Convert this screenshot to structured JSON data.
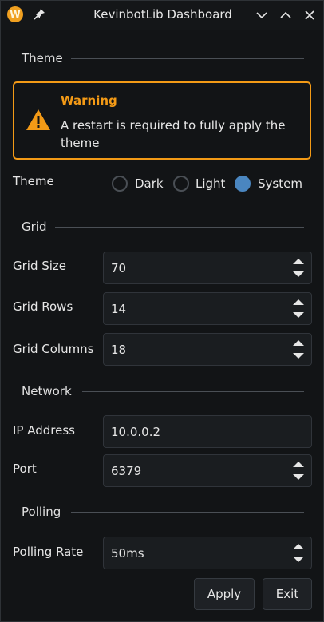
{
  "window": {
    "title": "KevinbotLib Dashboard",
    "app_icon_letter": "W"
  },
  "sections": {
    "theme": "Theme",
    "grid": "Grid",
    "network": "Network",
    "polling": "Polling"
  },
  "warning": {
    "title": "Warning",
    "text": "A restart is required to fully apply the theme"
  },
  "theme": {
    "label": "Theme",
    "options": [
      {
        "label": "Dark",
        "selected": false
      },
      {
        "label": "Light",
        "selected": false
      },
      {
        "label": "System",
        "selected": true
      }
    ]
  },
  "grid": {
    "size": {
      "label": "Grid Size",
      "value": "70"
    },
    "rows": {
      "label": "Grid Rows",
      "value": "14"
    },
    "columns": {
      "label": "Grid Columns",
      "value": "18"
    }
  },
  "network": {
    "ip": {
      "label": "IP Address",
      "value": "10.0.0.2"
    },
    "port": {
      "label": "Port",
      "value": "6379"
    }
  },
  "polling": {
    "rate": {
      "label": "Polling Rate",
      "value": "50ms"
    }
  },
  "buttons": {
    "apply": "Apply",
    "exit": "Exit"
  },
  "colors": {
    "accent": "#f39a16",
    "radio_selected": "#4a86c0",
    "background": "#121416"
  }
}
